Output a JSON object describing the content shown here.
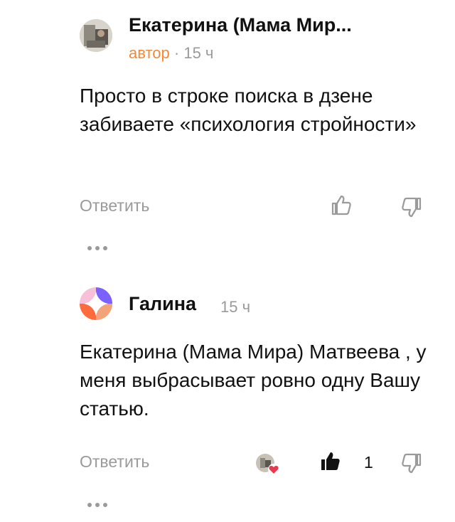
{
  "comments": [
    {
      "author": "Екатерина (Мама Мир...",
      "badge": "автор",
      "separator": "·",
      "time": "15 ч",
      "text": "Просто в строке поиска в дзене забиваете «психология стройности»",
      "reply_label": "Ответить"
    },
    {
      "author": "Галина",
      "time": "15 ч",
      "text": "Екатерина (Мама Мира) Матвеева , у меня выбрасывает ровно одну Вашу статью.",
      "reply_label": "Ответить",
      "like_count": "1"
    }
  ],
  "colors": {
    "author_badge": "#f08a3a",
    "muted": "#9a9a9a",
    "liked_heart": "#e8394d",
    "avatar_purple": "#7b61ff",
    "avatar_orange": "#ff6a3d",
    "avatar_pink": "#f7c0d8",
    "avatar_peach": "#f4a27a"
  },
  "icons": [
    "thumb-up-icon",
    "thumb-down-icon",
    "more-dots-icon",
    "liked-avatar-heart-icon"
  ]
}
